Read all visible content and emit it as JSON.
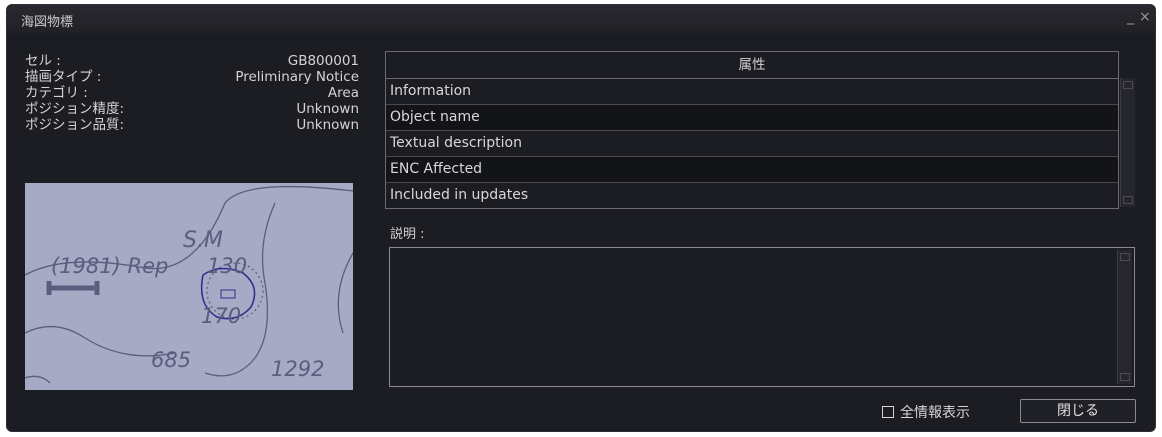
{
  "window": {
    "title": "海図物標",
    "minimize_glyph": "_",
    "close_glyph": "×"
  },
  "info": [
    {
      "label": "セル :",
      "value": "GB800001"
    },
    {
      "label": "描画タイプ :",
      "value": "Preliminary Notice"
    },
    {
      "label": "カテゴリ :",
      "value": "Area"
    },
    {
      "label": "ポジション精度:",
      "value": "Unknown"
    },
    {
      "label": "ポジション品質:",
      "value": "Unknown"
    }
  ],
  "map": {
    "labels": [
      "S.M",
      "(1981) Rep",
      "130",
      "170",
      "685",
      "1292"
    ],
    "colors": {
      "background": "#a7aac4",
      "ink": "#5a5e7e",
      "highlight": "#2b2f8a"
    }
  },
  "attributes": {
    "header": "属性",
    "rows": [
      "Information",
      "Object name",
      "Textual description",
      "ENC Affected",
      "Included in updates"
    ]
  },
  "description": {
    "label": "説明 :",
    "text": ""
  },
  "footer": {
    "show_all_label": "全情報表示",
    "show_all_checked": false,
    "close_label": "閉じる"
  }
}
